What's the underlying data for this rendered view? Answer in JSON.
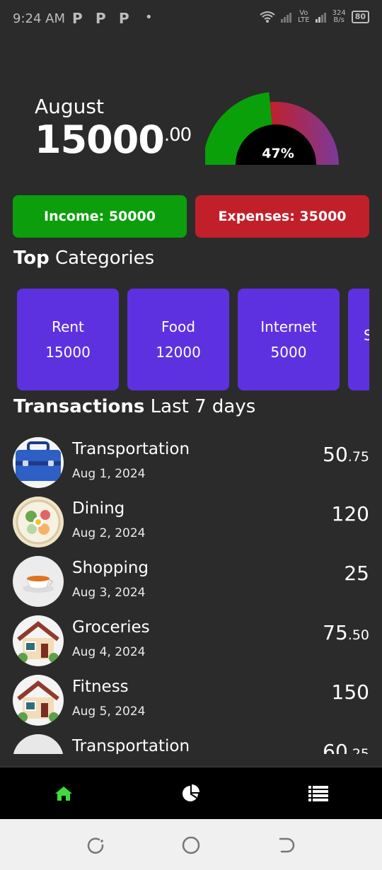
{
  "status_bar": {
    "time": "9:24 AM",
    "notif_1": "P",
    "notif_2": "P",
    "notif_3": "P",
    "dot": "•",
    "network_top": "Vo",
    "network_bottom": "LTE",
    "speed_top": "324",
    "speed_bottom": "B/s",
    "battery": "80"
  },
  "summary": {
    "month": "August",
    "amount_whole": "15000",
    "amount_decimal": ".00",
    "gauge_percent_label": "47%",
    "gauge_percent": 47,
    "gauge_colors": {
      "spent": "#0aa00a",
      "remaining_start": "#c1202b",
      "remaining_end": "#7a3a9a",
      "center": "#000000"
    }
  },
  "income_label": "Income: 50000",
  "expenses_label": "Expenses: 35000",
  "top_categories": {
    "title_bold": "Top",
    "title_rest": " Categories",
    "items": [
      {
        "name": "Rent",
        "amount": "15000"
      },
      {
        "name": "Food",
        "amount": "12000"
      },
      {
        "name": "Internet",
        "amount": "5000"
      },
      {
        "name": "S",
        "amount": ""
      }
    ]
  },
  "transactions": {
    "title_bold": "Transactions",
    "title_rest": " Last 7 days",
    "items": [
      {
        "title": "Transportation",
        "date": "Aug 1, 2024",
        "amount_whole": "50",
        "amount_decimal": ".75",
        "icon": "briefcase-icon"
      },
      {
        "title": "Dining",
        "date": "Aug 2, 2024",
        "amount_whole": "120",
        "amount_decimal": "",
        "icon": "food-plate-icon"
      },
      {
        "title": "Shopping",
        "date": "Aug 3, 2024",
        "amount_whole": "25",
        "amount_decimal": "",
        "icon": "tea-cup-icon"
      },
      {
        "title": "Groceries",
        "date": "Aug 4, 2024",
        "amount_whole": "75",
        "amount_decimal": ".50",
        "icon": "house-icon"
      },
      {
        "title": "Fitness",
        "date": "Aug 5, 2024",
        "amount_whole": "150",
        "amount_decimal": "",
        "icon": "house-icon"
      },
      {
        "title": "Transportation",
        "date": "",
        "amount_whole": "60",
        "amount_decimal": ".25",
        "icon": "plate-icon"
      }
    ]
  },
  "nav": {
    "home_icon": "home-icon",
    "chart_icon": "pie-chart-icon",
    "list_icon": "list-icon",
    "active_color": "#3ddc3d"
  }
}
